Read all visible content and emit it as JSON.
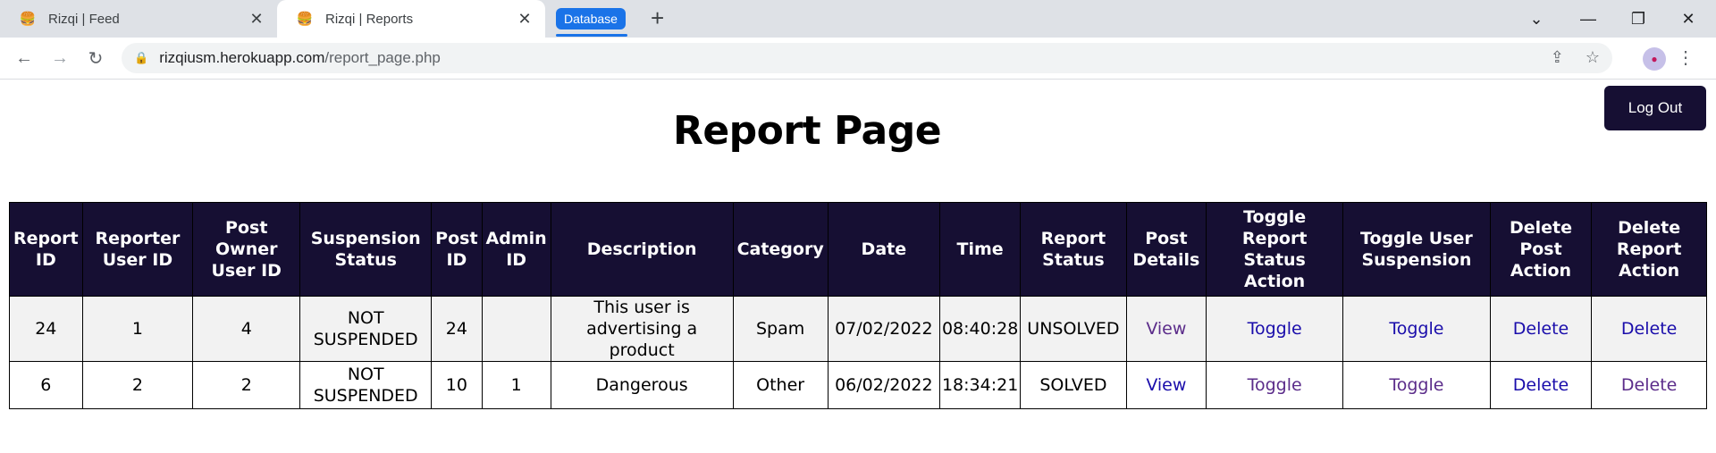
{
  "browser": {
    "tabs": [
      {
        "title": "Rizqi | Feed",
        "active": false
      },
      {
        "title": "Rizqi | Reports",
        "active": true
      }
    ],
    "bookmark_badge": "Database",
    "url_host": "rizqiusm.herokuapp.com",
    "url_path": "/report_page.php",
    "accent": "#1a73e8"
  },
  "page": {
    "title": "Report Page",
    "logout_label": "Log Out",
    "header_color": "#160f33"
  },
  "table": {
    "headers": [
      "Report ID",
      "Reporter User ID",
      "Post Owner User ID",
      "Suspension Status",
      "Post ID",
      "Admin ID",
      "Description",
      "Category",
      "Date",
      "Time",
      "Report Status",
      "Post Details",
      "Toggle Report Status Action",
      "Toggle User Suspension",
      "Delete Post Action",
      "Delete Report Action"
    ],
    "rows": [
      {
        "report_id": "24",
        "reporter_user_id": "1",
        "post_owner_user_id": "4",
        "suspension_status": "NOT SUSPENDED",
        "post_id": "24",
        "admin_id": "",
        "description": "This user is advertising a product",
        "category": "Spam",
        "date": "07/02/2022",
        "time": "08:40:28",
        "report_status": "UNSOLVED",
        "post_details": "View",
        "toggle_report": "Toggle",
        "toggle_user": "Toggle",
        "delete_post": "Delete",
        "delete_report": "Delete"
      },
      {
        "report_id": "6",
        "reporter_user_id": "2",
        "post_owner_user_id": "2",
        "suspension_status": "NOT SUSPENDED",
        "post_id": "10",
        "admin_id": "1",
        "description": "Dangerous",
        "category": "Other",
        "date": "06/02/2022",
        "time": "18:34:21",
        "report_status": "SOLVED",
        "post_details": "View",
        "toggle_report": "Toggle",
        "toggle_user": "Toggle",
        "delete_post": "Delete",
        "delete_report": "Delete"
      }
    ]
  }
}
